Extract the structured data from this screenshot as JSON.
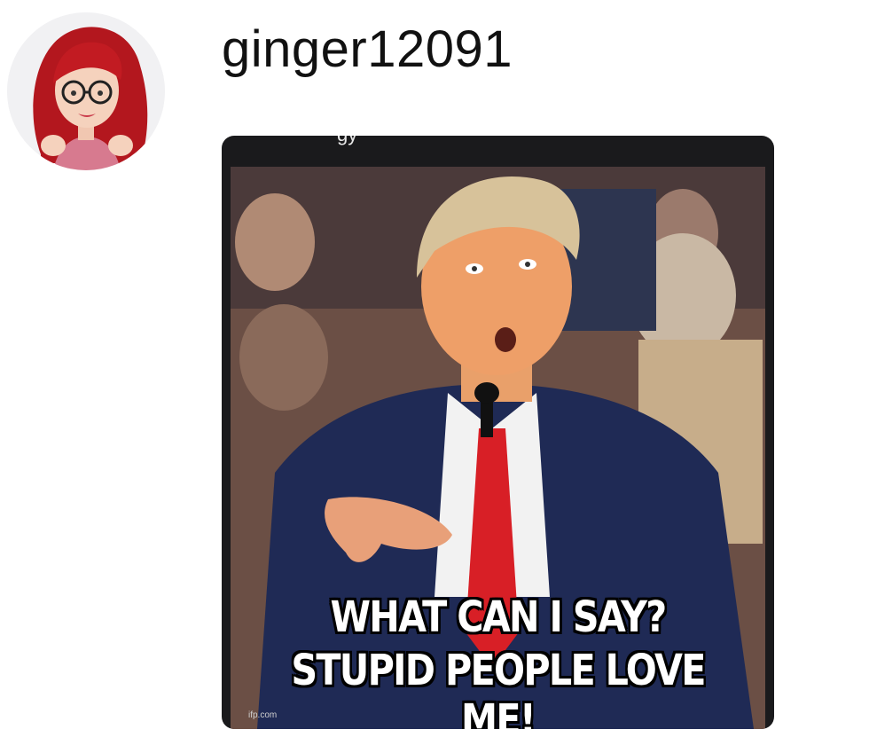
{
  "post": {
    "username": "ginger12091",
    "avatar_icon": "bitmoji-avatar-icon",
    "media": {
      "top_cut_text": "gy",
      "caption_line1": "WHAT CAN I SAY?",
      "caption_line2": "STUPID PEOPLE LOVE ME!",
      "watermark": "ifp.com"
    }
  },
  "colors": {
    "username": "#111111",
    "card_bg": "#1a1a1c",
    "tie": "#d81f26",
    "suit": "#1f2a55"
  }
}
